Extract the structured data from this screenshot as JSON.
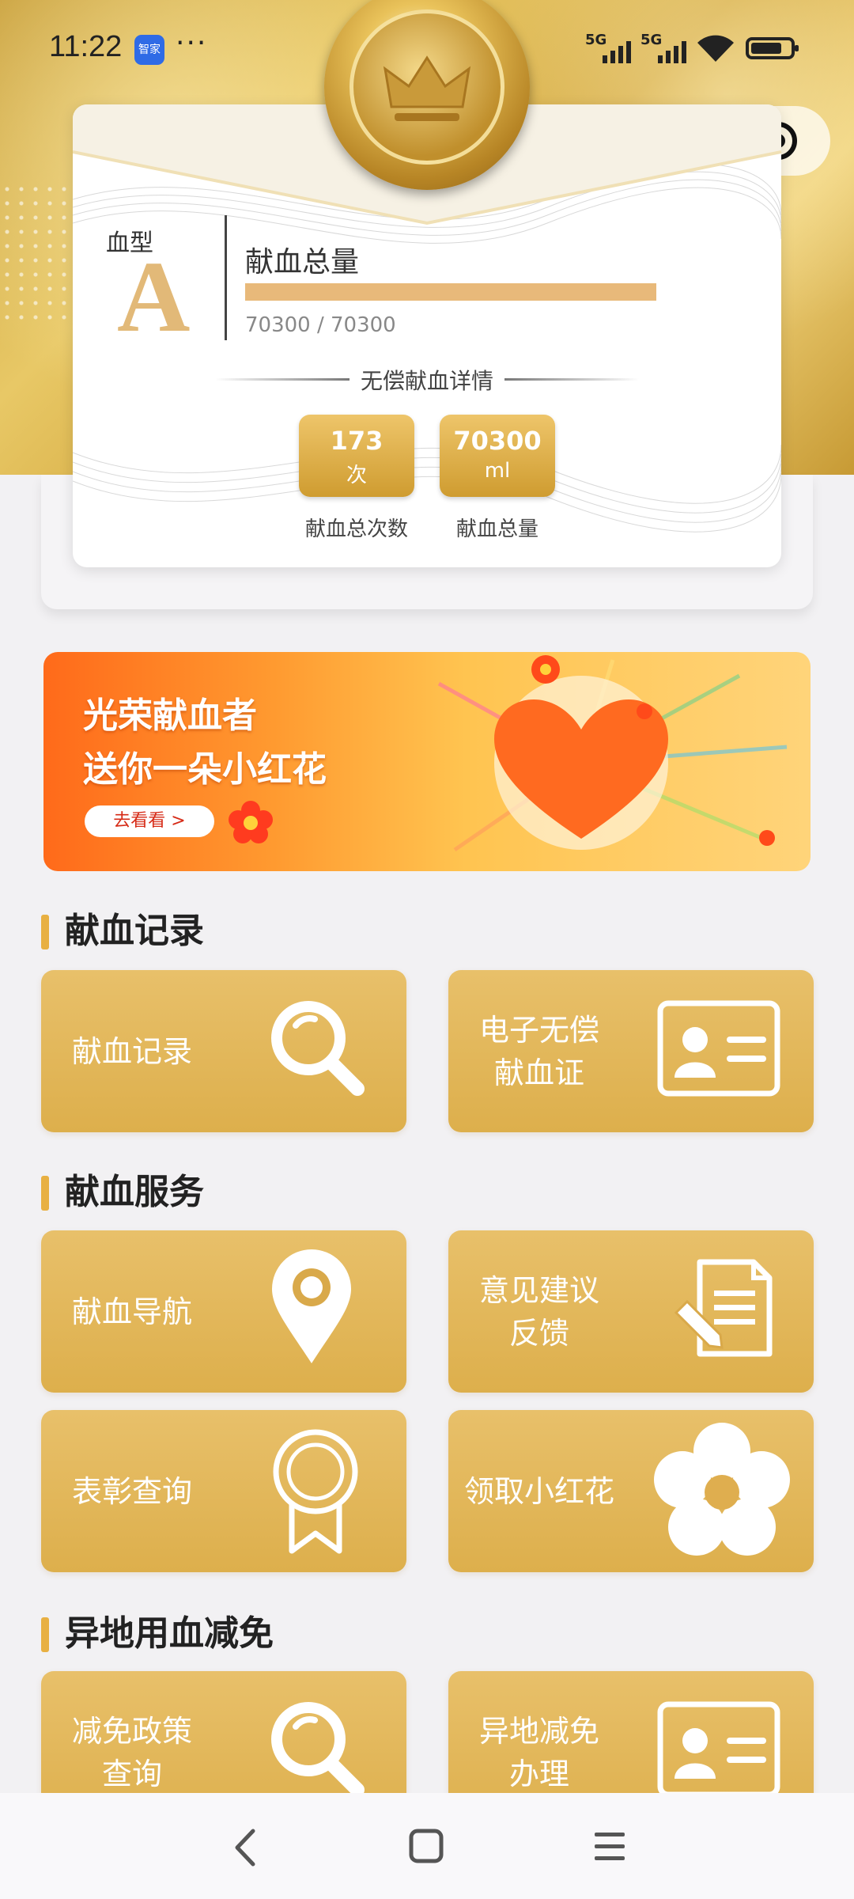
{
  "status_bar": {
    "time": "11:22",
    "app_badge": "智家",
    "more": "···",
    "signal_1": "5G",
    "signal_2": "5G"
  },
  "capsule": {
    "more_label": "•••"
  },
  "card": {
    "blood_type_label": "血型",
    "blood_type": "A",
    "total_title": "献血总量",
    "progress": {
      "current": 70300,
      "max": 70300,
      "fraction": 1.0
    },
    "total_value_text": "70300 / 70300",
    "detail_heading": "无偿献血详情",
    "stats": [
      {
        "value": "173",
        "unit": "次",
        "caption": "献血总次数"
      },
      {
        "value": "70300",
        "unit": "ml",
        "caption": "献血总量"
      }
    ]
  },
  "banner": {
    "line1": "光荣献血者",
    "line2": "送你一朵小红花",
    "button": "去看看 >"
  },
  "sections": [
    {
      "title": "献血记录",
      "tiles": [
        {
          "label": "献血记录",
          "icon": "magnifier-icon"
        },
        {
          "label": "电子无偿\n献血证",
          "icon": "id-card-icon"
        }
      ]
    },
    {
      "title": "献血服务",
      "tiles": [
        {
          "label": "献血导航",
          "icon": "location-pin-icon"
        },
        {
          "label": "意见建议\n反馈",
          "icon": "document-edit-icon"
        },
        {
          "label": "表彰查询",
          "icon": "award-ribbon-icon"
        },
        {
          "label": "领取小红花",
          "icon": "flower-icon"
        }
      ]
    },
    {
      "title": "异地用血减免",
      "tiles": [
        {
          "label": "减免政策\n查询",
          "icon": "magnifier-icon"
        },
        {
          "label": "异地减免\n办理",
          "icon": "id-card-icon"
        }
      ]
    }
  ],
  "colors": {
    "gold": "#ddaf4c",
    "accent_bar": "#e8b042",
    "progress": "#e8b97a",
    "banner_orange": "#ff6a1a"
  }
}
